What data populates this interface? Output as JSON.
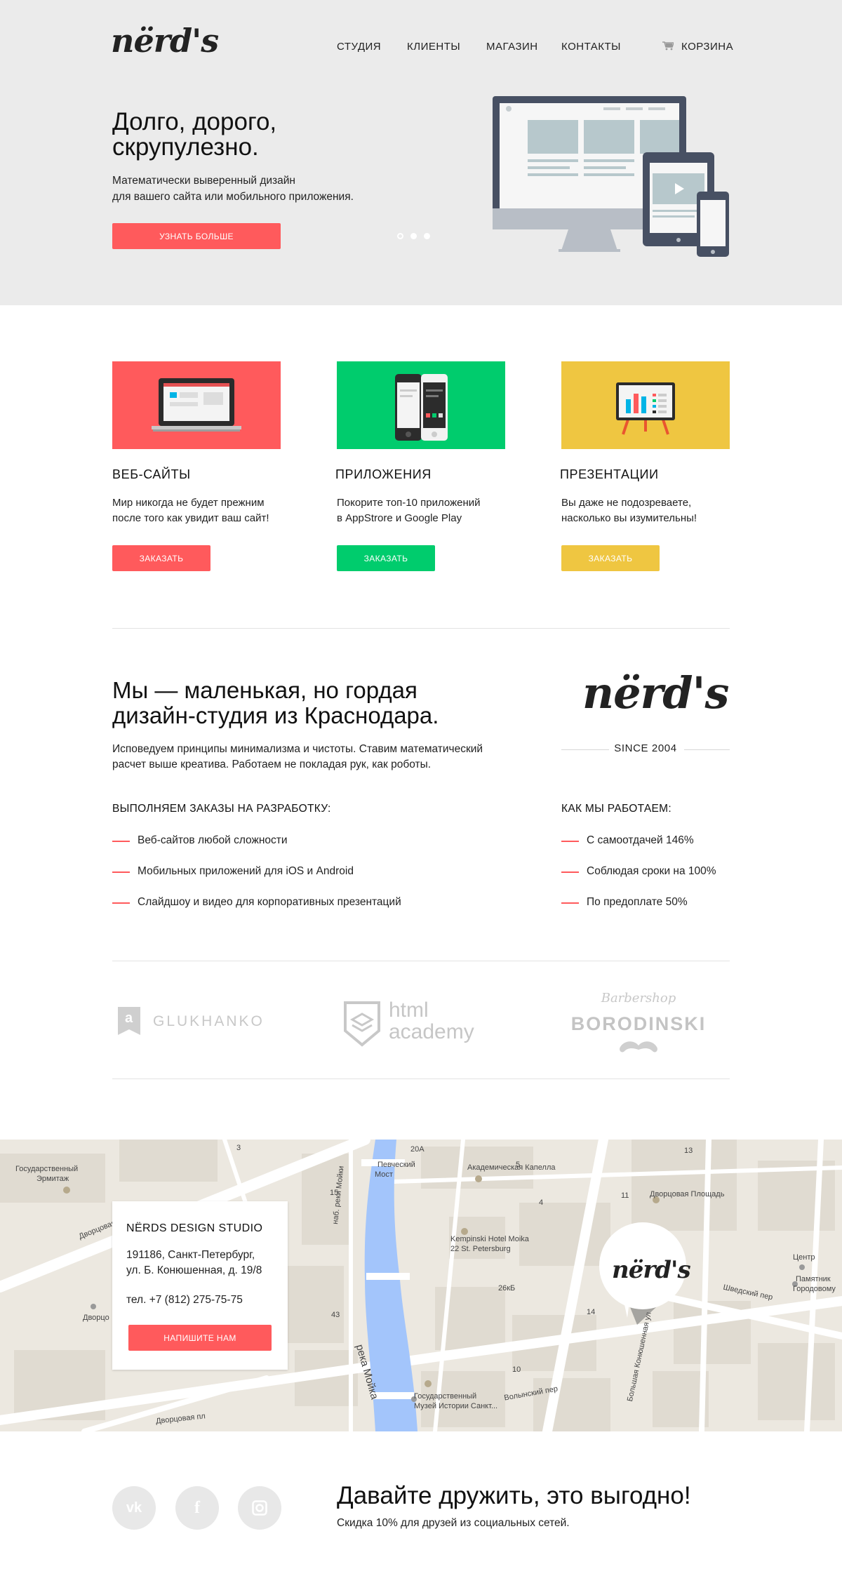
{
  "brand": {
    "logo": "nërd's",
    "logo_alt": "nërd's logo"
  },
  "nav": {
    "items": [
      "СТУДИЯ",
      "КЛИЕНТЫ",
      "МАГАЗИН",
      "КОНТАКТЫ"
    ],
    "cart_label": "КОРЗИНА",
    "cart_icon": "cart-icon"
  },
  "hero": {
    "title": "Долго, дорого, скрупулезно.",
    "subtitle_line1": "Математически выверенный дизайн",
    "subtitle_line2": "для вашего сайта или мобильного приложения.",
    "button": "УЗНАТЬ БОЛЬШЕ",
    "slider_dots": 3,
    "active_dot": 1
  },
  "services": [
    {
      "title": "ВЕБ-САЙТЫ",
      "text_line1": "Мир никогда не будет прежним",
      "text_line2": "после того как увидит ваш сайт!",
      "button": "ЗАКАЗАТЬ",
      "color": "#ff5a5c",
      "icon": "laptop-icon"
    },
    {
      "title": "ПРИЛОЖЕНИЯ",
      "text_line1": "Покорите топ-10 приложений",
      "text_line2": "в AppStrore и Google Play",
      "button": "ЗАКАЗАТЬ",
      "color": "#00cc6d",
      "icon": "smartphones-icon"
    },
    {
      "title": "ПРЕЗЕНТАЦИИ",
      "text_line1": "Вы даже не подозреваете,",
      "text_line2": "насколько вы изумительны!",
      "button": "ЗАКАЗАТЬ",
      "color": "#efc641",
      "icon": "presentation-board-icon"
    }
  ],
  "about": {
    "title_line1": "Мы — маленькая, но гордая",
    "title_line2": "дизайн-студия из Краснодара.",
    "text_line1": "Исповедуем принципы минимализма и чистоты. Ставим математический",
    "text_line2": "расчет выше креатива. Работаем не покладая рук, как роботы.",
    "since": "SINCE 2004",
    "orders_head": "ВЫПОЛНЯЕМ ЗАКАЗЫ НА РАЗРАБОТКУ:",
    "orders": [
      "Веб-сайтов любой сложности",
      "Мобильных приложений для iOS и Android",
      "Слайдшоу и видео для корпоративных презентаций"
    ],
    "how_head": "КАК МЫ РАБОТАЕМ:",
    "how": [
      "С самоотдачей 146%",
      "Соблюдая сроки на 100%",
      "По предоплате 50%"
    ]
  },
  "partners": {
    "glukhanko": "GLUKHANKO",
    "glukhanko_mark": "a",
    "html_academy_1": "html",
    "html_academy_2": "academy",
    "barbershop": "Barbershop",
    "borodinski": "BORODINSKI"
  },
  "map": {
    "labels": [
      "Государственный",
      "Эрмитаж",
      "Дворцовая наб.",
      "Певческий",
      "Мост",
      "Академическая Капелла",
      "Дворцовая Площадь",
      "Kempinski Hotel Moika",
      "22 St. Petersburg",
      "наб. реки Мойки",
      "река Мойка",
      "Шведский пер",
      "Центр",
      "Памятник",
      "Городовому",
      "Волынский пер",
      "Государственный",
      "Музей Истории Санкт...",
      "Большая Конюшенная ул",
      "Дворцовая пл",
      "Дворцо",
      "20А",
      "11",
      "13",
      "5",
      "43",
      "26кБ",
      "10",
      "3",
      "15",
      "14",
      "4"
    ],
    "pin_logo": "nërd's"
  },
  "contact": {
    "title": "NËRDS DESIGN STUDIO",
    "addr_line1": "191186, Санкт-Петербург,",
    "addr_line2": "ул. Б. Конюшенная, д. 19/8",
    "tel": "тел. +7 (812) 275-75-75",
    "button": "НАПИШИТЕ НАМ"
  },
  "footer": {
    "social": [
      {
        "icon": "vk-icon",
        "glyph": "vk"
      },
      {
        "icon": "facebook-icon",
        "glyph": "f"
      },
      {
        "icon": "instagram-icon",
        "glyph": "◙"
      }
    ],
    "title": "Давайте дружить, это выгодно!",
    "subtitle": "Скидка 10% для друзей из социальных сетей."
  }
}
